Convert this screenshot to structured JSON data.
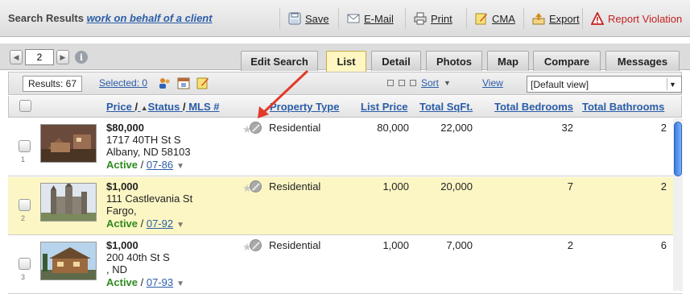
{
  "header": {
    "title_prefix": "Search Results",
    "title_link": "work on behalf of a client",
    "buttons": {
      "save": "Save",
      "email": "E-Mail",
      "print": "Print",
      "cma": "CMA",
      "export": "Export",
      "report": "Report Violation"
    }
  },
  "pager": {
    "page": "2"
  },
  "tabs": [
    "Edit Search",
    "List",
    "Detail",
    "Photos",
    "Map",
    "Compare",
    "Messages"
  ],
  "active_tab": "List",
  "results": {
    "count_label": "Results: 67",
    "selected_label": "Selected: 0",
    "sort_label": "Sort",
    "view_label": "View",
    "view_selected": "[Default view]"
  },
  "columns": {
    "price": "Price",
    "sep": "/",
    "status": "Status",
    "mls": "MLS #",
    "property_type": "Property Type",
    "list_price": "List Price",
    "total_sqft": "Total SqFt.",
    "total_bedrooms": "Total Bedrooms",
    "total_bathrooms": "Total Bathrooms"
  },
  "rows": [
    {
      "num": "1",
      "price": "$80,000",
      "addr1": "1717 40TH St S",
      "addr2": "Albany, ND 58103",
      "status": "Active",
      "mls": "07-86",
      "property_type": "Residential",
      "list_price": "80,000",
      "sqft": "22,000",
      "bedrooms": "32",
      "bathrooms": "2"
    },
    {
      "num": "2",
      "price": "$1,000",
      "addr1": "111 Castlevania St",
      "addr2": "Fargo,",
      "status": "Active",
      "mls": "07-92",
      "property_type": "Residential",
      "list_price": "1,000",
      "sqft": "20,000",
      "bedrooms": "7",
      "bathrooms": "2"
    },
    {
      "num": "3",
      "price": "$1,000",
      "addr1": "200 40th St S",
      "addr2": ", ND",
      "status": "Active",
      "mls": "07-93",
      "property_type": "Residential",
      "list_price": "1,000",
      "sqft": "7,000",
      "bedrooms": "2",
      "bathrooms": "6"
    }
  ],
  "colors": {
    "link": "#2b5da8",
    "active_status": "#2e8b1f",
    "highlight_row": "#fcf6c4",
    "violation": "#c62020",
    "arrow": "#e23a2a"
  }
}
